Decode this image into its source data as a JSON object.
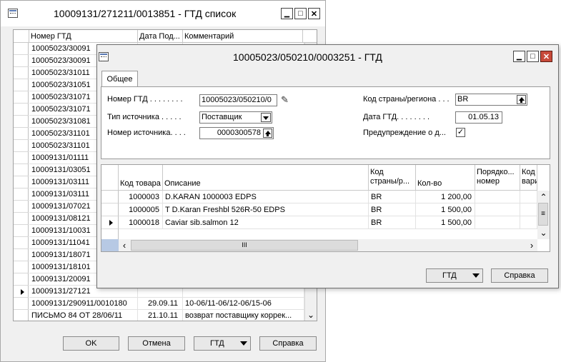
{
  "back_window": {
    "title": "10009131/271211/0013851 - ГТД список",
    "columns": [
      "Номер ГТД",
      "Дата Под...",
      "Комментарий"
    ],
    "rows": [
      {
        "number": "10005023/30091",
        "date": "",
        "comment": ""
      },
      {
        "number": "10005023/30091",
        "date": "",
        "comment": ""
      },
      {
        "number": "10005023/31011",
        "date": "",
        "comment": ""
      },
      {
        "number": "10005023/31051",
        "date": "",
        "comment": ""
      },
      {
        "number": "10005023/31071",
        "date": "",
        "comment": ""
      },
      {
        "number": "10005023/31071",
        "date": "",
        "comment": ""
      },
      {
        "number": "10005023/31081",
        "date": "",
        "comment": ""
      },
      {
        "number": "10005023/31101",
        "date": "",
        "comment": ""
      },
      {
        "number": "10005023/31101",
        "date": "",
        "comment": ""
      },
      {
        "number": "10009131/01111",
        "date": "",
        "comment": ""
      },
      {
        "number": "10009131/03051",
        "date": "",
        "comment": ""
      },
      {
        "number": "10009131/03111",
        "date": "",
        "comment": ""
      },
      {
        "number": "10009131/03111",
        "date": "",
        "comment": ""
      },
      {
        "number": "10009131/07021",
        "date": "",
        "comment": ""
      },
      {
        "number": "10009131/08121",
        "date": "",
        "comment": ""
      },
      {
        "number": "10009131/10031",
        "date": "",
        "comment": ""
      },
      {
        "number": "10009131/11041",
        "date": "",
        "comment": ""
      },
      {
        "number": "10009131/18071",
        "date": "",
        "comment": ""
      },
      {
        "number": "10009131/18101",
        "date": "",
        "comment": ""
      },
      {
        "number": "10009131/20091",
        "date": "",
        "comment": ""
      },
      {
        "number": "10009131/27121",
        "date": "",
        "comment": ""
      },
      {
        "number": "10009131/290911/0010180",
        "date": "29.09.11",
        "comment": "10-06/11-06/12-06/15-06"
      },
      {
        "number": "ПИСЬМО 84 ОТ 28/06/11",
        "date": "21.10.11",
        "comment": "возврат поставщику коррек..."
      }
    ],
    "current_row_index": 20,
    "buttons": {
      "ok": "OK",
      "cancel": "Отмена",
      "gtd": "ГТД",
      "help": "Справка"
    }
  },
  "front_window": {
    "title": "10005023/050210/0003251 - ГТД",
    "tab": "Общее",
    "fields": {
      "gtd_number": {
        "label": "Номер ГТД . . . . . . . .",
        "value": "10005023/050210/0"
      },
      "source_type": {
        "label": "Тип источника . . . . .",
        "value": "Поставщик"
      },
      "source_number": {
        "label": "Номер источника. . . .",
        "value": "0000300578"
      },
      "country_code": {
        "label": "Код страны/региона . . .",
        "value": "BR"
      },
      "gtd_date": {
        "label": "Дата ГТД. . . . . . . .",
        "value": "01.05.13"
      },
      "warning": {
        "label": "Предупреждение о д...",
        "checked": true,
        "mark": "✓"
      }
    },
    "lines": {
      "columns": {
        "item_code": "Код товара",
        "description": "Описание",
        "country": [
          "Код",
          "страны/р..."
        ],
        "qty": "Кол-во",
        "order": [
          "Порядко...",
          "номер"
        ],
        "variant": [
          "Код",
          "вари"
        ]
      },
      "rows": [
        {
          "item_code": "1000003",
          "description": "D.KARAN 1000003 EDPS",
          "country": "BR",
          "qty": "1 200,00",
          "current": false
        },
        {
          "item_code": "1000005",
          "description": "T D.Karan Freshbl 526R-50 EDPS",
          "country": "BR",
          "qty": "1 500,00",
          "current": false
        },
        {
          "item_code": "1000018",
          "description": "Caviar sib.salmon 12",
          "country": "BR",
          "qty": "1 500,00",
          "current": true
        }
      ],
      "hscroll_grip": "III",
      "vscroll_grip": "≡"
    },
    "buttons": {
      "gtd": "ГТД",
      "help": "Справка"
    },
    "title_buttons": {
      "minimize": "▁",
      "maximize": "□",
      "close": "✕"
    }
  },
  "icons": {
    "edit": "✎",
    "scroll_up": "⌃",
    "scroll_down": "⌄",
    "scroll_left": "‹",
    "scroll_right": "›"
  }
}
